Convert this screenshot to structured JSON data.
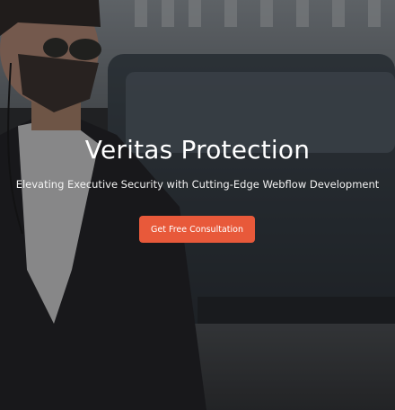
{
  "hero": {
    "title": "Veritas Protection",
    "subtitle": "Elevating Executive Security with Cutting-Edge Webflow Development",
    "cta_label": "Get Free Consultation",
    "cta_color": "#e8593a",
    "background_image": "security-agent-with-sunglasses-and-earpiece-photo"
  }
}
